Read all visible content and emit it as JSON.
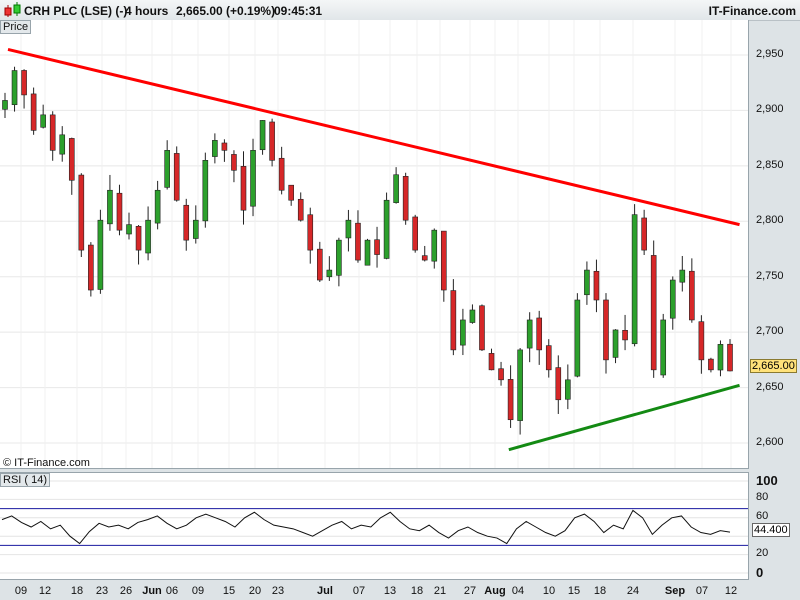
{
  "header": {
    "symbol": "CRH PLC (LSE) (-)",
    "interval": "4 hours",
    "price": "2,665.00 (+0.19%)",
    "time": "09:45:31",
    "brand": "IT-Finance.com"
  },
  "price_panel": {
    "label": "Price",
    "copyright": "© IT-Finance.com",
    "last_price": "2,665.00"
  },
  "rsi_panel": {
    "label": "RSI ( 14)",
    "last_value": "44.400"
  },
  "colors": {
    "up": "#2ca02c",
    "down": "#d62728",
    "resistance": "#ff0000",
    "support": "#138a13",
    "rsi_bands": "#1a1aa0"
  },
  "chart_data": [
    {
      "type": "candlestick",
      "title": "CRH PLC (LSE) 4 hours",
      "ylabel": "Price",
      "ylim": [
        2580,
        2980
      ],
      "yticks": [
        "2,950",
        "2,900",
        "2,850",
        "2,800",
        "2,750",
        "2,700",
        "2,650",
        "2,600"
      ],
      "ytick_values": [
        2950,
        2900,
        2850,
        2800,
        2750,
        2700,
        2650,
        2600
      ],
      "xticks": [
        "09",
        "12",
        "18",
        "23",
        "26",
        "Jun",
        "06",
        "09",
        "15",
        "20",
        "23",
        "Jul",
        "07",
        "13",
        "18",
        "21",
        "27",
        "Aug",
        "04",
        "10",
        "15",
        "18",
        "24",
        "Sep",
        "07",
        "12"
      ],
      "closes": [
        2909,
        2936,
        2914,
        2882,
        2896,
        2864,
        2878,
        2837,
        2774,
        2738,
        2801,
        2828,
        2792,
        2797,
        2774,
        2801,
        2828,
        2864,
        2819,
        2783,
        2801,
        2855,
        2873,
        2864,
        2846,
        2810,
        2864,
        2891,
        2855,
        2828,
        2819,
        2801,
        2774,
        2747,
        2756,
        2783,
        2801,
        2765,
        2783,
        2770,
        2819,
        2842,
        2801,
        2774,
        2765,
        2792,
        2738,
        2684,
        2711,
        2720,
        2684,
        2666,
        2657,
        2621,
        2684,
        2711,
        2684,
        2666,
        2639,
        2657,
        2729,
        2756,
        2729,
        2675,
        2702,
        2693,
        2806,
        2774,
        2666,
        2711,
        2747,
        2756,
        2711,
        2675,
        2666,
        2689,
        2665
      ],
      "trendlines": [
        {
          "name": "resistance",
          "start_index": 0,
          "start_price": 2955,
          "end_index": 77,
          "end_price": 2797
        },
        {
          "name": "support",
          "start_index": 52.5,
          "start_price": 2594,
          "end_index": 77,
          "end_price": 2652
        }
      ]
    },
    {
      "type": "line",
      "title": "RSI ( 14)",
      "ylim": [
        0,
        100
      ],
      "yticks": [
        "100",
        "80",
        "60",
        "40",
        "20",
        "0"
      ],
      "ytick_values": [
        100,
        80,
        60,
        40,
        20,
        0
      ],
      "bands": [
        30,
        70
      ],
      "values": [
        58,
        62,
        55,
        50,
        56,
        48,
        52,
        40,
        32,
        45,
        54,
        50,
        52,
        48,
        55,
        58,
        62,
        54,
        48,
        52,
        60,
        64,
        60,
        56,
        50,
        60,
        66,
        58,
        52,
        50,
        48,
        44,
        40,
        46,
        52,
        56,
        48,
        52,
        50,
        60,
        66,
        56,
        48,
        46,
        52,
        44,
        38,
        46,
        50,
        44,
        40,
        38,
        32,
        48,
        56,
        50,
        44,
        40,
        46,
        60,
        64,
        56,
        44,
        52,
        48,
        68,
        60,
        42,
        52,
        60,
        62,
        50,
        44,
        42,
        46,
        44.4
      ]
    }
  ]
}
